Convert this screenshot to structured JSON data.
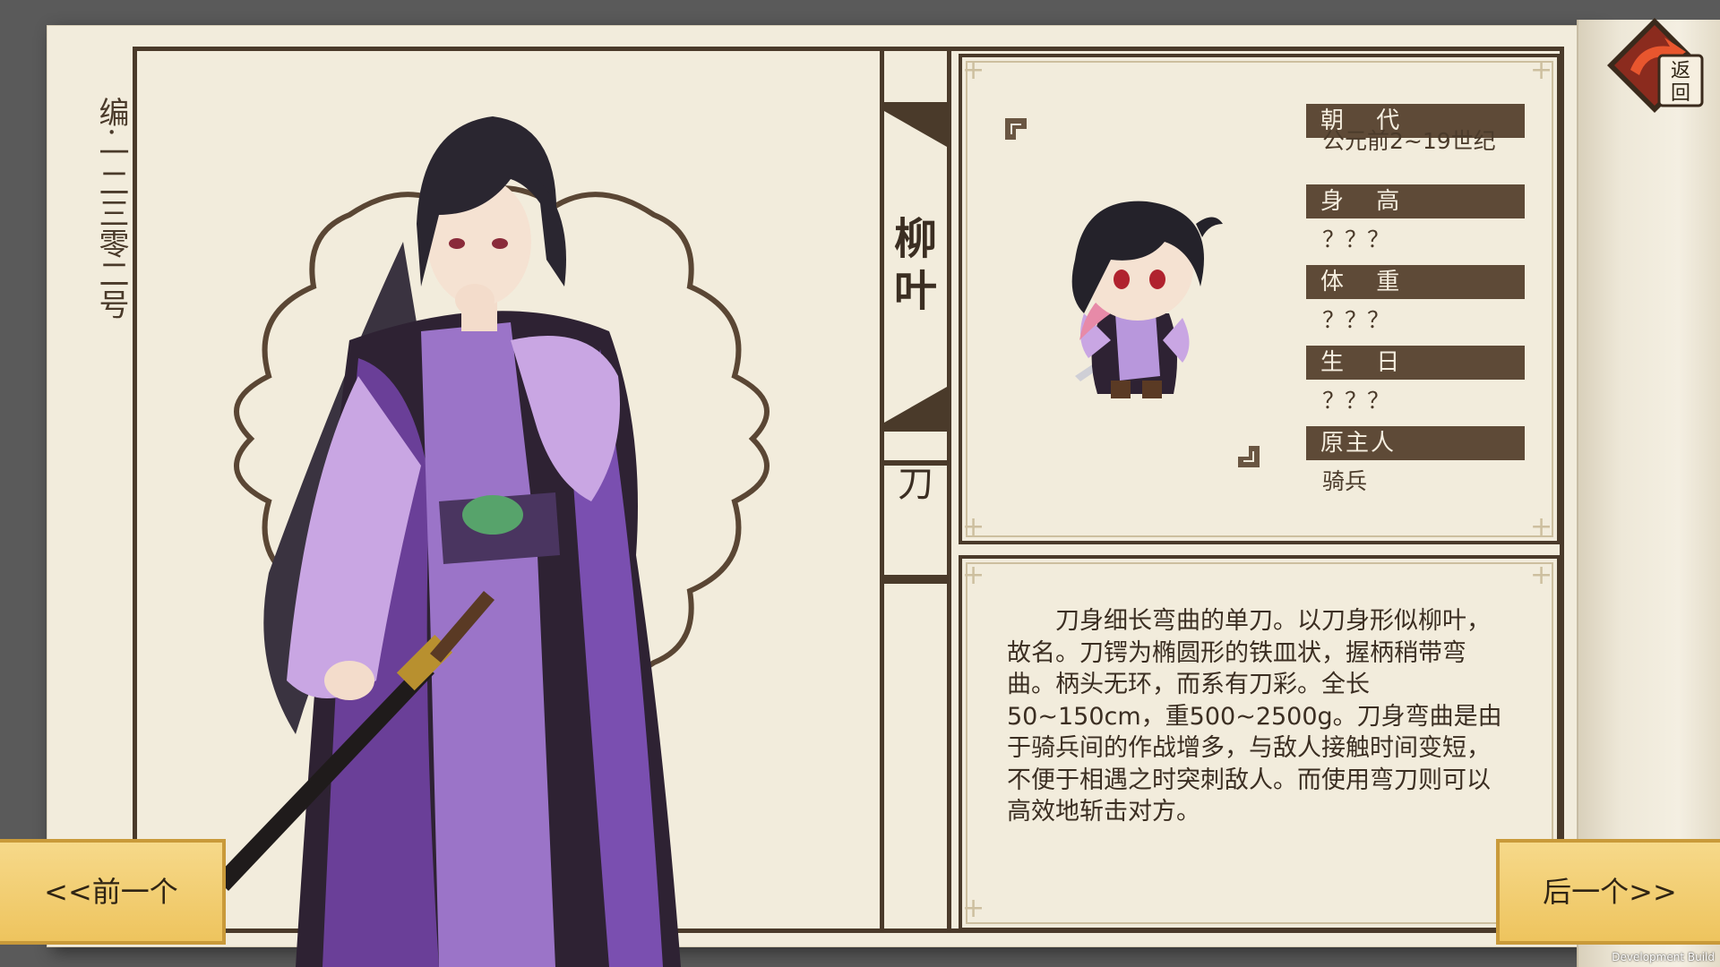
{
  "side_label": "编·一二三零二号",
  "character": {
    "name": "柳叶",
    "type": "刀"
  },
  "fields": [
    {
      "label": "朝 代",
      "value": "公元前2~19世纪"
    },
    {
      "label": "身 高",
      "value": "？？？"
    },
    {
      "label": "体 重",
      "value": "？？？"
    },
    {
      "label": "生 日",
      "value": "？？？"
    },
    {
      "label": "原主人",
      "value": "骑兵"
    }
  ],
  "description": "刀身细长弯曲的单刀。以刀身形似柳叶，故名。刀锷为椭圆形的铁皿状，握柄稍带弯曲。柄头无环，而系有刀彩。全长50~150cm，重500~2500g。刀身弯曲是由于骑兵间的作战增多，与敌人接触时间变短，不便于相遇之时突刺敌人。而使用弯刀则可以高效地斩击对方。",
  "nav": {
    "prev_label": "<<前一个",
    "next_label": "后一个>>",
    "back_label": "返回"
  },
  "dev_build": "Development Build",
  "colors": {
    "paper": "#f2ecdc",
    "frame": "#4a3a2a",
    "field_bar": "#5e4a37",
    "button_yellow": "#f2cf73",
    "robe_purple": "#7b4fa8",
    "robe_light": "#c9a6e3"
  }
}
